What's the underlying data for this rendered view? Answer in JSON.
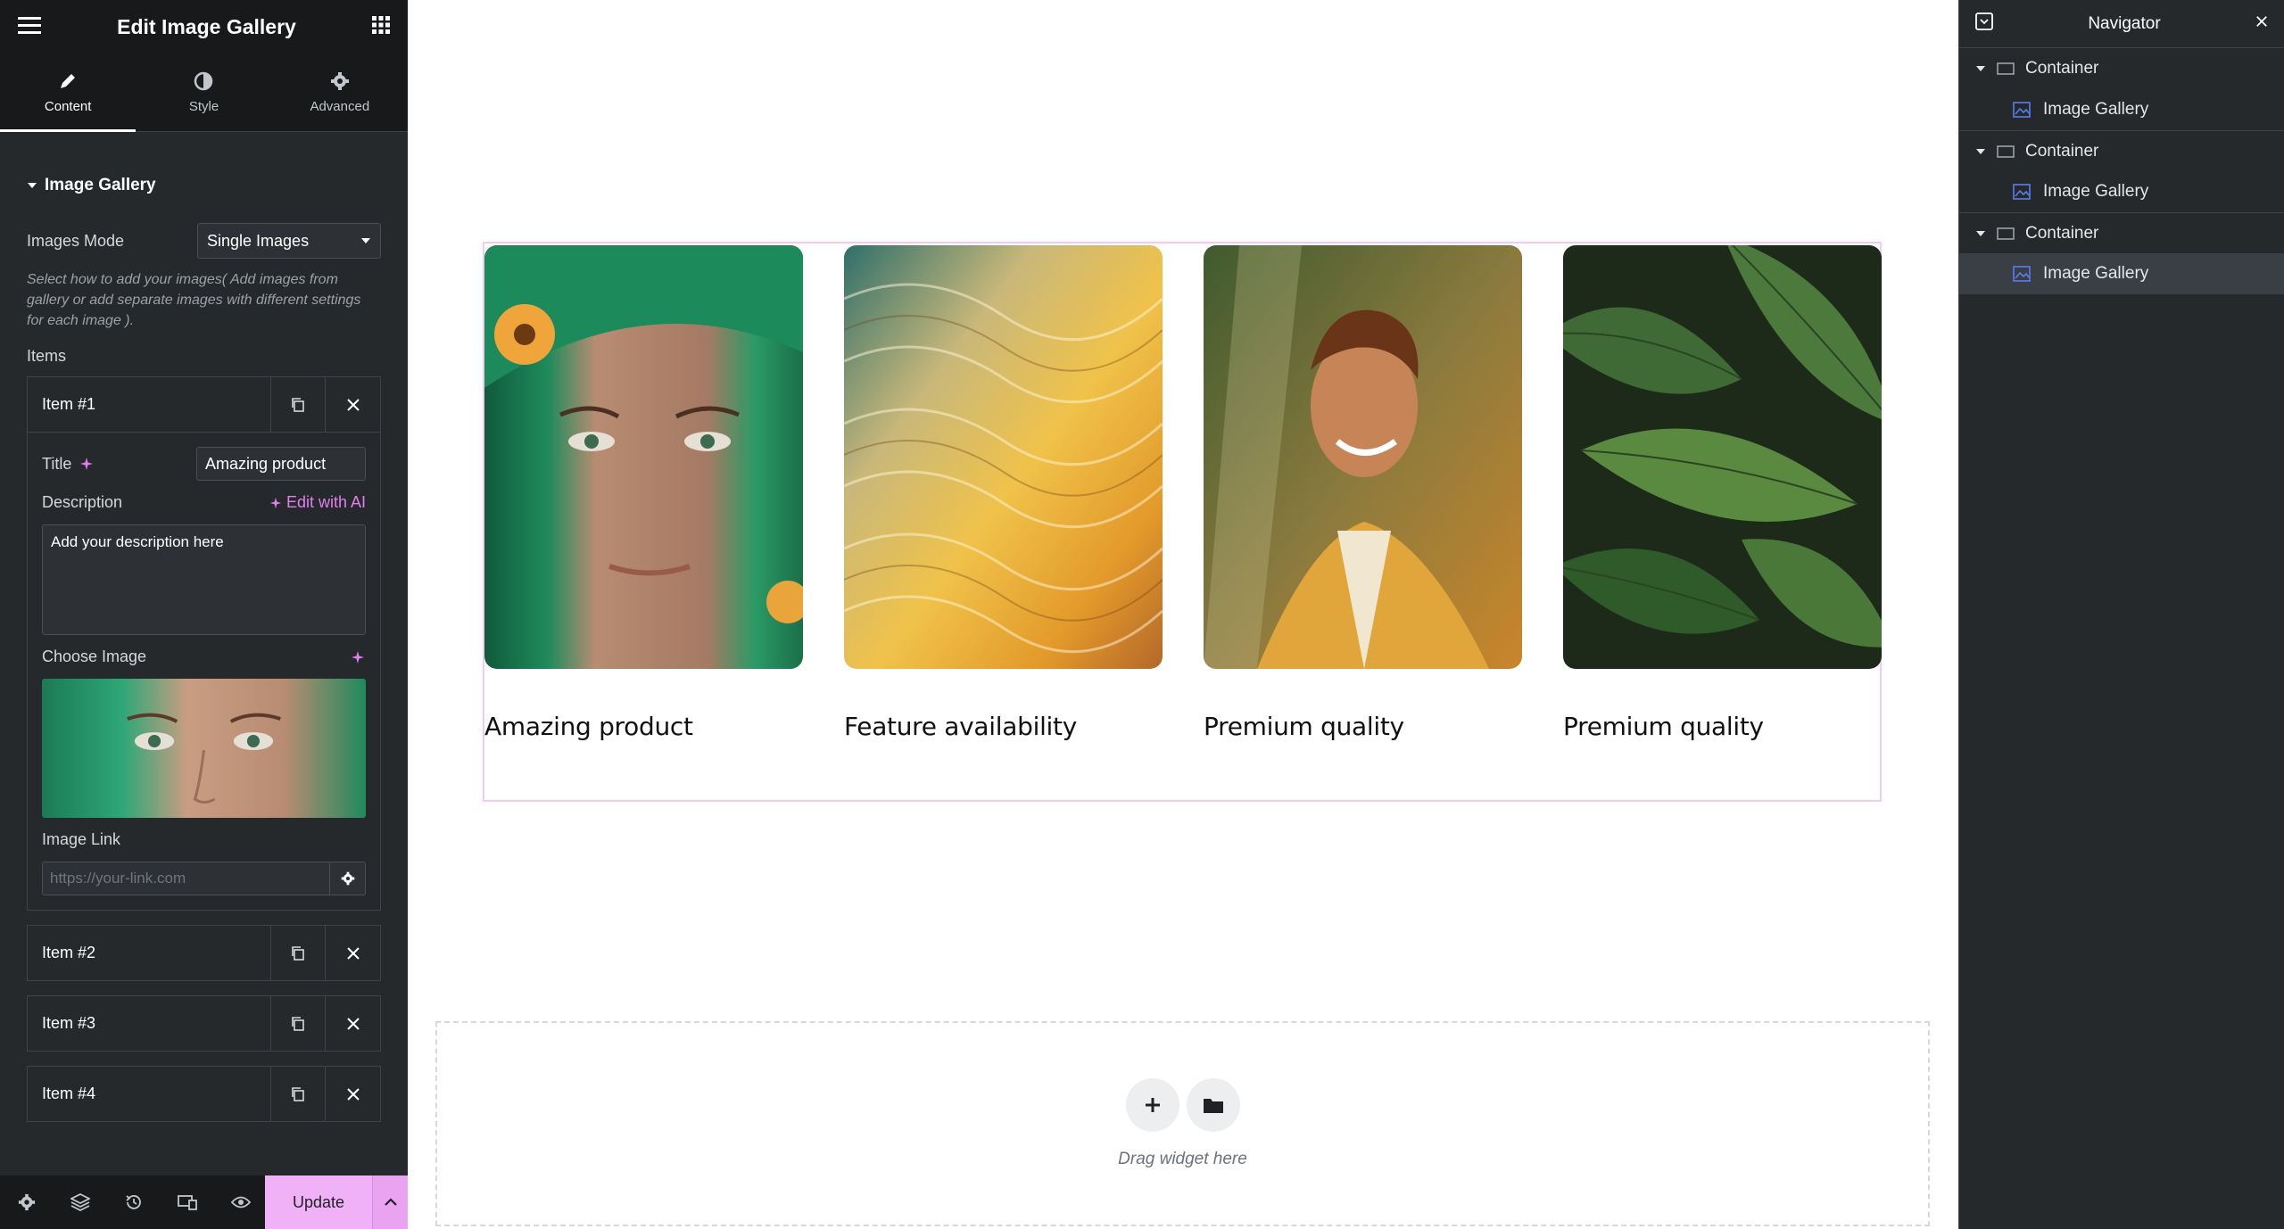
{
  "panel": {
    "title": "Edit Image Gallery",
    "tabs": [
      {
        "label": "Content"
      },
      {
        "label": "Style"
      },
      {
        "label": "Advanced"
      }
    ],
    "section_title": "Image Gallery",
    "images_mode_label": "Images Mode",
    "images_mode_value": "Single Images",
    "help_text": "Select how to add your images( Add images from gallery or add separate images with different settings for each image ).",
    "items_label": "Items",
    "items": [
      {
        "label": "Item #1"
      },
      {
        "label": "Item #2"
      },
      {
        "label": "Item #3"
      },
      {
        "label": "Item #4"
      }
    ],
    "item1": {
      "title_label": "Title",
      "title_value": "Amazing product",
      "description_label": "Description",
      "edit_ai_label": "Edit with AI",
      "description_value": "Add your description here",
      "choose_image_label": "Choose Image",
      "image_link_label": "Image Link",
      "image_link_placeholder": "https://your-link.com"
    },
    "update_label": "Update"
  },
  "canvas": {
    "captions": [
      "Amazing product",
      "Feature availability",
      "Premium quality",
      "Premium quality"
    ],
    "drop_text": "Drag widget here"
  },
  "navigator": {
    "title": "Navigator",
    "tree": [
      {
        "container": "Container",
        "child": "Image Gallery"
      },
      {
        "container": "Container",
        "child": "Image Gallery"
      },
      {
        "container": "Container",
        "child": "Image Gallery"
      }
    ]
  },
  "colors": {
    "accent": "#f0b1f7",
    "ai": "#e07ef0",
    "panel_bg": "#26292c"
  }
}
